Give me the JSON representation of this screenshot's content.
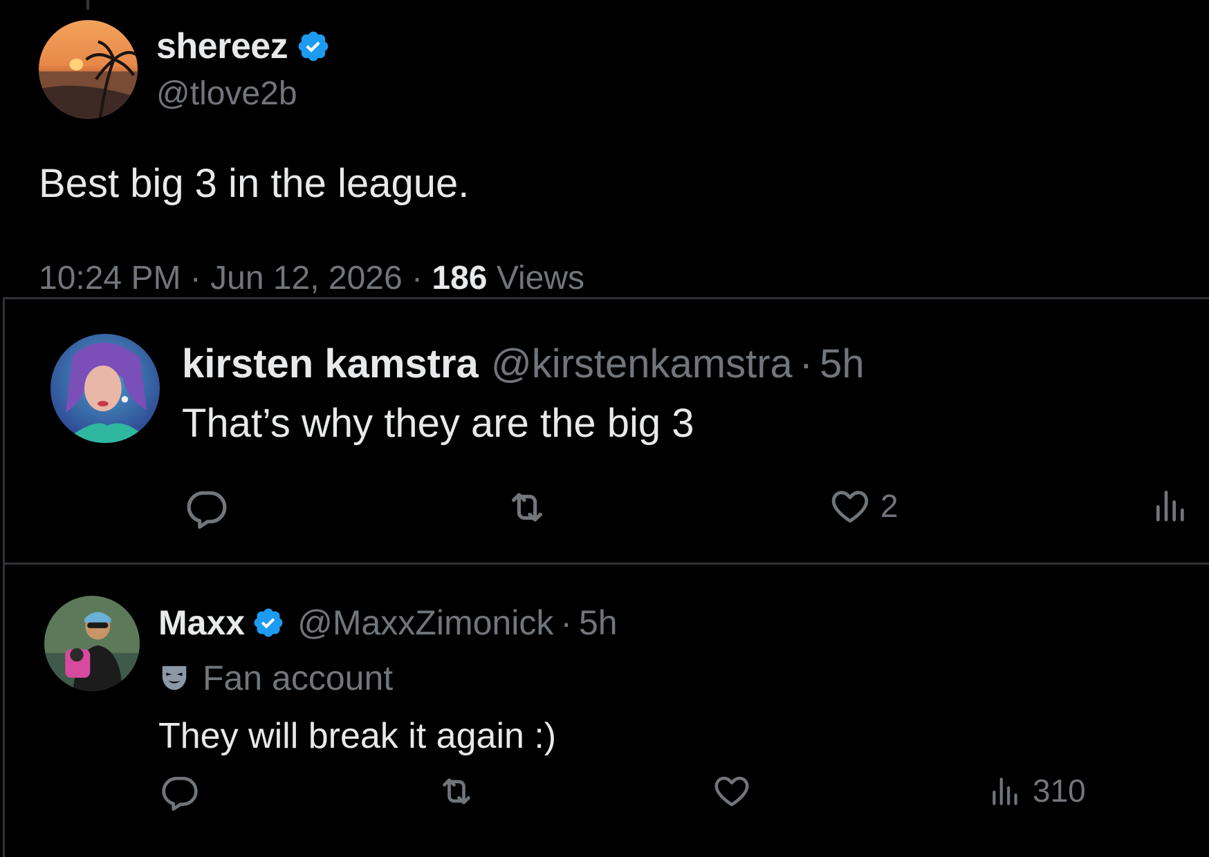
{
  "main_post": {
    "display_name": "shereez",
    "handle": "@tlove2b",
    "verified": true,
    "text": "Best big 3 in the league.",
    "time": "10:24 PM",
    "separator": "·",
    "date": "Jun 12, 2026",
    "views_count": "186",
    "views_label": "Views"
  },
  "replies": [
    {
      "display_name": "kirsten kamstra",
      "handle": "@kirstenkamstra",
      "separator": "·",
      "time": "5h",
      "text": "That’s why they are the big 3",
      "actions": {
        "reply_icon": "reply-icon",
        "retweet_icon": "retweet-icon",
        "like_icon": "heart-icon",
        "like_count": "2",
        "views_icon": "views-icon"
      }
    },
    {
      "display_name": "Maxx",
      "verified": true,
      "handle": "@MaxxZimonick",
      "separator": "·",
      "time": "5h",
      "label": "Fan account",
      "text": "They will break it again :)",
      "actions": {
        "reply_icon": "reply-icon",
        "retweet_icon": "retweet-icon",
        "like_icon": "heart-icon",
        "views_icon": "views-icon",
        "views_count": "310"
      }
    }
  ],
  "colors": {
    "background": "#000000",
    "primary_text": "#e7e9ea",
    "secondary_text": "#71767b",
    "verified_blue": "#1d9bf0",
    "divider": "#2f3336"
  }
}
